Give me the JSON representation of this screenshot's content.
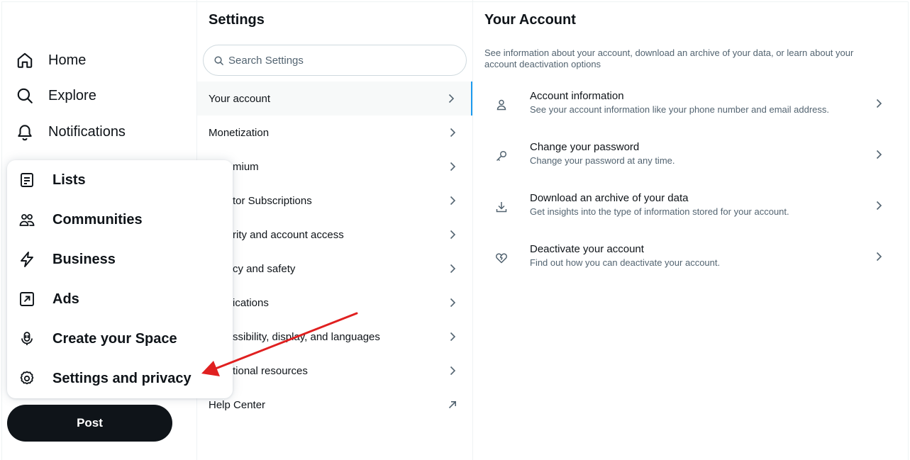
{
  "nav": {
    "home": "Home",
    "explore": "Explore",
    "notifications": "Notifications"
  },
  "popup": {
    "items": [
      "Lists",
      "Communities",
      "Business",
      "Ads",
      "Create your Space",
      "Settings and privacy"
    ]
  },
  "post_label": "Post",
  "settings": {
    "title": "Settings",
    "search_placeholder": "Search Settings",
    "items": [
      "Your account",
      "Monetization",
      "mium",
      "tor Subscriptions",
      "rity and account access",
      "cy and safety",
      "ications",
      "ssibility, display, and languages",
      "tional resources",
      "Help Center"
    ]
  },
  "account": {
    "title": "Your Account",
    "description": "See information about your account, download an archive of your data, or learn about your account deactivation options",
    "rows": [
      {
        "title": "Account information",
        "subtitle": "See your account information like your phone number and email address.",
        "icon": "person-icon"
      },
      {
        "title": "Change your password",
        "subtitle": "Change your password at any time.",
        "icon": "key-icon"
      },
      {
        "title": "Download an archive of your data",
        "subtitle": "Get insights into the type of information stored for your account.",
        "icon": "download-icon"
      },
      {
        "title": "Deactivate your account",
        "subtitle": "Find out how you can deactivate your account.",
        "icon": "broken-heart-icon"
      }
    ]
  },
  "colors": {
    "accent": "#1d9bf0",
    "annotation_arrow": "#e02020",
    "post_button": "#0f1419"
  }
}
